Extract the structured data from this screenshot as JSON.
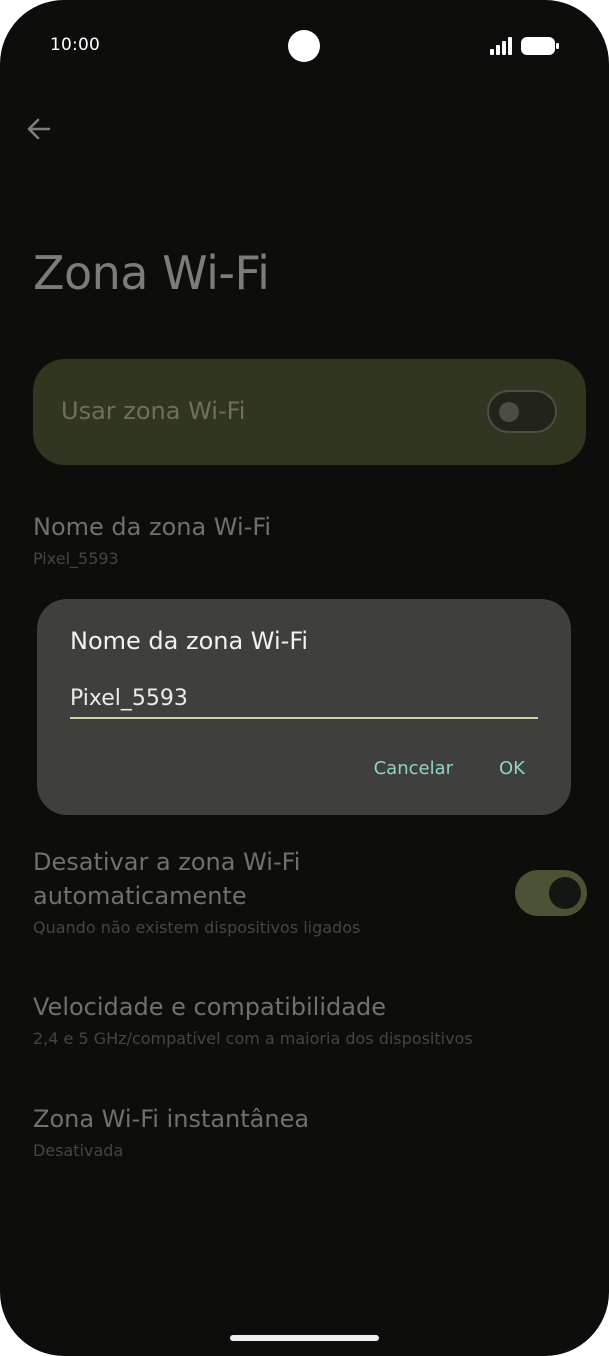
{
  "status_bar": {
    "time": "10:00",
    "signal_icon": "signal-icon",
    "battery_icon": "battery-icon"
  },
  "header": {
    "back_icon": "arrow-left-icon",
    "title": "Zona Wi-Fi"
  },
  "master_switch": {
    "label": "Usar zona Wi-Fi",
    "enabled": false
  },
  "settings": [
    {
      "title": "Nome da zona Wi-Fi",
      "subtitle": "Pixel_5593"
    },
    {
      "title": "Desativar a zona Wi-Fi automaticamente",
      "title_line1": "Desativar a zona Wi-Fi",
      "title_line2": "automaticamente",
      "subtitle": "Quando não existem dispositivos ligados",
      "enabled": true
    },
    {
      "title": "Velocidade e compatibilidade",
      "subtitle": "2,4 e 5 GHz/compatível com a maioria dos dispositivos"
    },
    {
      "title": "Zona Wi-Fi instantânea",
      "subtitle": "Desativada"
    }
  ],
  "dialog": {
    "title": "Nome da zona Wi-Fi",
    "input_value": "Pixel_5593",
    "cancel_label": "Cancelar",
    "ok_label": "OK"
  },
  "colors": {
    "accent": "#8fd4c6",
    "input_underline": "#cdd5a4",
    "dialog_bg": "#3f3f3d"
  }
}
